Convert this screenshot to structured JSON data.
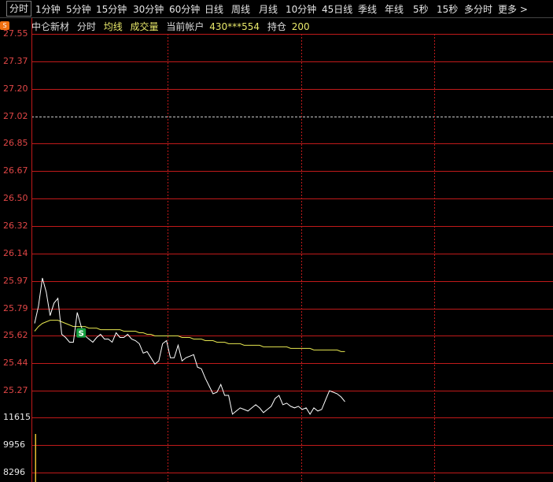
{
  "tabs": [
    "分时",
    "1分钟",
    "5分钟",
    "15分钟",
    "30分钟",
    "60分钟",
    "日线",
    "周线",
    "月线",
    "10分钟",
    "45日线",
    "季线",
    "年线",
    "5秒",
    "15秒",
    "多分时",
    "更多 >"
  ],
  "active_tab": "分时",
  "logo_text": "S",
  "info": {
    "name": "中仑新材",
    "mode": "分时",
    "ma_label": "均线",
    "vol_label": "成交量",
    "account_label": "当前帐户",
    "account": "430***554",
    "position_label": "持仓",
    "position": "200"
  },
  "colors": {
    "grid": "#c01a1a",
    "axis_label": "#e04646",
    "price_line": "#ffffff",
    "avg_line": "#e6e650",
    "signal": "#18a040",
    "volume": "#e8c030",
    "info_label": "#dddddd",
    "info_value": "#e8e86a"
  },
  "price_axis_labels": [
    "27.55",
    "27.37",
    "27.20",
    "27.02",
    "26.85",
    "26.67",
    "26.50",
    "26.32",
    "26.14",
    "25.97",
    "25.79",
    "25.62",
    "25.44",
    "25.27"
  ],
  "volume_axis_labels": [
    "11615",
    "9956",
    "8296"
  ],
  "chart_data": {
    "type": "line",
    "reference_price": 27.02,
    "price_range": [
      25.27,
      27.55
    ],
    "volume_range": [
      8296,
      11615
    ],
    "signal_label": "S",
    "signal_index": 12,
    "price": [
      25.7,
      25.81,
      25.99,
      25.9,
      25.75,
      25.83,
      25.86,
      25.63,
      25.61,
      25.58,
      25.58,
      25.77,
      25.68,
      25.62,
      25.6,
      25.58,
      25.61,
      25.63,
      25.6,
      25.6,
      25.58,
      25.64,
      25.61,
      25.61,
      25.63,
      25.6,
      25.59,
      25.57,
      25.51,
      25.52,
      25.48,
      25.44,
      25.46,
      25.57,
      25.59,
      25.48,
      25.48,
      25.56,
      25.46,
      25.48,
      25.49,
      25.5,
      25.42,
      25.41,
      25.35,
      25.3,
      25.25,
      25.26,
      25.31,
      25.24,
      25.24,
      25.12,
      25.14,
      25.16,
      25.15,
      25.14,
      25.16,
      25.18,
      25.16,
      25.13,
      25.15,
      25.17,
      25.22,
      25.24,
      25.18,
      25.19,
      25.17,
      25.16,
      25.17,
      25.15,
      25.16,
      25.12,
      25.16,
      25.14,
      25.15,
      25.21,
      25.27,
      25.26,
      25.25,
      25.23,
      25.2
    ],
    "avg": [
      25.65,
      25.68,
      25.7,
      25.71,
      25.72,
      25.72,
      25.72,
      25.71,
      25.7,
      25.69,
      25.68,
      25.68,
      25.68,
      25.68,
      25.67,
      25.67,
      25.67,
      25.66,
      25.66,
      25.66,
      25.66,
      25.66,
      25.66,
      25.65,
      25.65,
      25.65,
      25.65,
      25.64,
      25.64,
      25.63,
      25.63,
      25.62,
      25.62,
      25.62,
      25.62,
      25.62,
      25.62,
      25.62,
      25.61,
      25.61,
      25.61,
      25.6,
      25.6,
      25.6,
      25.59,
      25.59,
      25.59,
      25.58,
      25.58,
      25.58,
      25.57,
      25.57,
      25.57,
      25.57,
      25.56,
      25.56,
      25.56,
      25.56,
      25.56,
      25.55,
      25.55,
      25.55,
      25.55,
      25.55,
      25.55,
      25.55,
      25.54,
      25.54,
      25.54,
      25.54,
      25.54,
      25.54,
      25.53,
      25.53,
      25.53,
      25.53,
      25.53,
      25.53,
      25.53,
      25.52,
      25.52
    ],
    "volume": [
      [
        0,
        11615
      ]
    ]
  }
}
